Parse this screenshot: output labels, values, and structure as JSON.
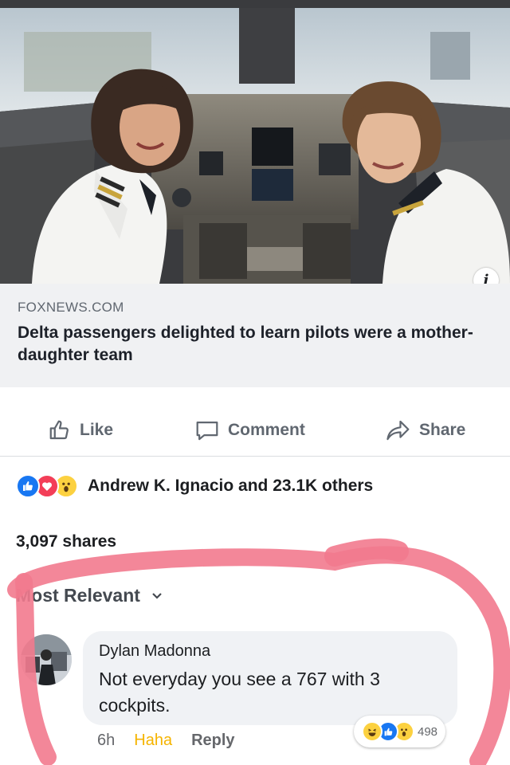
{
  "post": {
    "link_domain": "FOXNEWS.COM",
    "link_title": "Delta passengers delighted to learn pilots were a mother-daughter team",
    "info_icon_char": "i"
  },
  "actions": {
    "like_label": "Like",
    "comment_label": "Comment",
    "share_label": "Share"
  },
  "reactions": {
    "summary": "Andrew K. Ignacio and 23.1K others",
    "icons": [
      "like-icon",
      "love-icon",
      "wow-icon"
    ]
  },
  "shares": {
    "text": "3,097 shares"
  },
  "comments": {
    "sort_label": "Most Relevant",
    "items": [
      {
        "author": "Dylan Madonna",
        "text": "Not everyday you see a 767 with 3 cockpits.",
        "time": "6h",
        "reaction_label": "Haha",
        "reply_label": "Reply",
        "reaction_count": "498",
        "reaction_icons": [
          "haha-icon",
          "like-icon",
          "wow-icon"
        ]
      }
    ]
  },
  "colors": {
    "facebook_blue": "#1877f2",
    "text_gray": "#606770",
    "link_box_bg": "#f0f1f3",
    "annotation_red": "#f27a8e",
    "haha_yellow": "#f5b400"
  }
}
